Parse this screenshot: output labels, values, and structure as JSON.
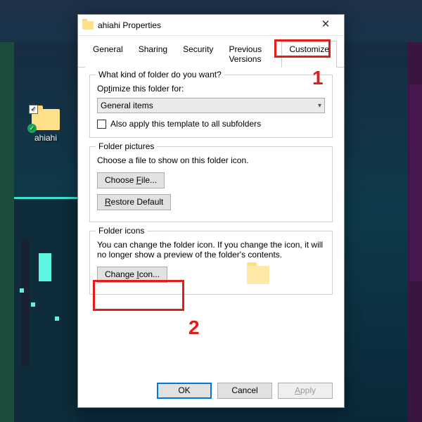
{
  "desktop": {
    "icon_label": "ahiahi"
  },
  "dialog": {
    "title": "ahiahi Properties",
    "tabs": [
      "General",
      "Sharing",
      "Security",
      "Previous Versions",
      "Customize"
    ],
    "active_tab_index": 4,
    "section_kind": {
      "legend": "What kind of folder do you want?",
      "optimize_label": "Optimize this folder for:",
      "optimize_value": "General items",
      "subfolders_label": "Also apply this template to all subfolders"
    },
    "section_pictures": {
      "legend": "Folder pictures",
      "desc": "Choose a file to show on this folder icon.",
      "choose_btn": "Choose File...",
      "restore_btn": "Restore Default"
    },
    "section_icons": {
      "legend": "Folder icons",
      "desc": "You can change the folder icon. If you change the icon, it will no longer show a preview of the folder's contents.",
      "change_btn": "Change Icon..."
    },
    "footer": {
      "ok": "OK",
      "cancel": "Cancel",
      "apply": "Apply"
    }
  },
  "annotations": {
    "one": "1",
    "two": "2"
  }
}
